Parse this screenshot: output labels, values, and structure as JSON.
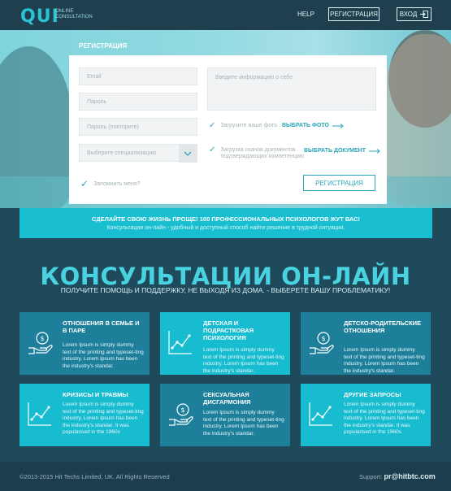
{
  "header": {
    "logo": "QUI",
    "logo_sub": "Online consultation",
    "help": "HELP",
    "register": "РЕГИСТРАЦИЯ",
    "login": "ВХОД"
  },
  "hero": {
    "title": "Регистрация"
  },
  "form": {
    "email": "Email",
    "password": "Пароль",
    "password_repeat": "Пароль (повторите)",
    "specialization": "Выберите специализацию",
    "about": "Введите информацию о себе",
    "photo_label": "Загрузите ваше фото",
    "photo_link": "ВЫБРАТЬ ФОТО",
    "doc_label_1": "Загрузка сканов документов",
    "doc_label_2": "подтверждающих компетенцию",
    "doc_link": "ВЫБРАТЬ ДОКУМЕНТ",
    "remember": "Запомнить меня?",
    "submit": "Регистрация"
  },
  "banner": {
    "title": "Сделайте свою жизнь проще!  100 профессиональных психологов жут вас!",
    "subtitle": "Консультации он-лайн - удобный и доступный способ найти решение в трудной ситуации."
  },
  "main": {
    "title": "КОНСУЛЬТАЦИИ ОН-ЛАЙН",
    "subtitle": "Получите помощь и поддержку, не выходя из дома. - выберете вашу проблематику!",
    "tiles": [
      {
        "title": "Отношения в семье и в паре",
        "text": "Lorem Ipsum is simply dummy text of the printing and typeset-ting industry. Lorem Ipsum has been the industry's standar."
      },
      {
        "title": "Детская и подрастковая психология",
        "text": "Lorem Ipsum is simply dummy text of the printing and typeset-ting industry. Lorem Ipsum has been the industry's standar."
      },
      {
        "title": "Детско-родительские отношения",
        "text": "Lorem Ipsum is simply dummy text of the printing and typeset-ting industry. Lorem Ipsum has been the industry's standar."
      },
      {
        "title": "Кризисы и травмы",
        "text": "Lorem Ipsum is simply dummy text of the printing and typeset-ting industry. Lorem Ipsum has been the industry's standar. It was popularised in the 1960s"
      },
      {
        "title": "Сексуальная дисгармония",
        "text": "Lorem Ipsum is simply dummy text of the printing and typeset-ting industry. Lorem Ipsum has been the industry's standar."
      },
      {
        "title": "Другие запросы",
        "text": "Lorem Ipsum is simply dummy text of the printing and typeset-ting industry. Lorem Ipsum has been the industry's standar. It was popularised in the 1960s"
      }
    ]
  },
  "footer": {
    "copyright": "©2013-2015 Hit Techs Limited, UK. All Rights Reserved",
    "support_label": "Support:",
    "support_email": "pr@hitbtc.com"
  },
  "colors": {
    "accent": "#19bfd1",
    "tile_dark": "#1e7f9b",
    "background": "#1e4a5c"
  }
}
